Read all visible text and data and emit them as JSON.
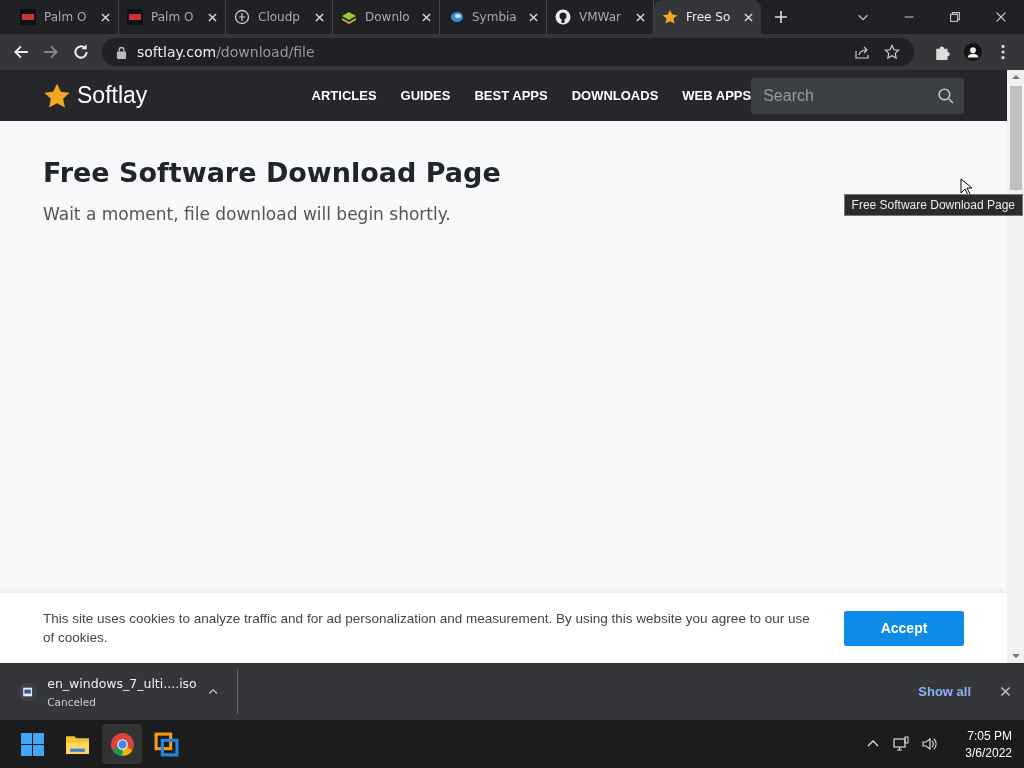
{
  "tabs": [
    {
      "kind": "pdb",
      "title": "Palm O",
      "selected": false
    },
    {
      "kind": "pdb",
      "title": "Palm O",
      "selected": false
    },
    {
      "kind": "globe",
      "title": "Cloudp",
      "selected": false
    },
    {
      "kind": "layers",
      "title": "Downlo",
      "selected": false
    },
    {
      "kind": "swirl",
      "title": "Symbia",
      "selected": false
    },
    {
      "kind": "github",
      "title": "VMWar",
      "selected": false
    },
    {
      "kind": "star",
      "title": "Free So",
      "selected": true
    }
  ],
  "address": {
    "domain": "softlay.com",
    "path": "/download/file"
  },
  "site": {
    "logo": "Softlay",
    "nav": [
      "ARTICLES",
      "GUIDES",
      "BEST APPS",
      "DOWNLOADS",
      "WEB APPS"
    ],
    "search": {
      "placeholder": "Search"
    }
  },
  "content": {
    "heading": "Free Software Download Page",
    "subtitle": "Wait a moment, file download will begin shortly."
  },
  "tooltip": "Free Software Download Page",
  "cookie_banner": {
    "text": "This site uses cookies to analyze traffic and for ad personalization and measurement. By using this website you agree to our use of cookies.",
    "button": "Accept"
  },
  "download_bar": {
    "file": "en_windows_7_ulti....iso",
    "status": "Canceled",
    "show_all": "Show all"
  },
  "taskbar": {
    "time": "7:05 PM",
    "date": "3/6/2022"
  }
}
